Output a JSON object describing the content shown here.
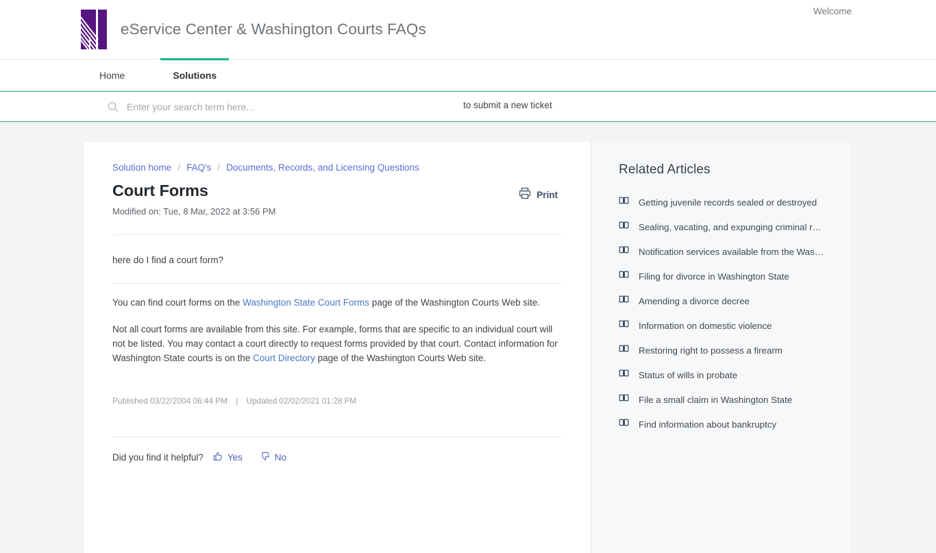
{
  "header": {
    "brand_title": "eService Center & Washington Courts FAQs",
    "welcome": "Welcome",
    "logo_color": "#56157f"
  },
  "nav": {
    "tabs": [
      {
        "label": "Home",
        "active": false
      },
      {
        "label": "Solutions",
        "active": true
      }
    ],
    "accent_color": "#12b886"
  },
  "search": {
    "placeholder": "Enter your search term here...",
    "value": "",
    "ticket_note": "to submit a new ticket",
    "border_color": "#2fae86"
  },
  "breadcrumb": {
    "items": [
      "Solution home",
      "FAQ's",
      "Documents, Records, and Licensing Questions"
    ],
    "separator": "/",
    "link_color": "#5f6bd4"
  },
  "article": {
    "title": "Court Forms",
    "modified": "Modified on: Tue, 8 Mar, 2022 at 3:56 PM",
    "print_label": "Print",
    "question": "here do I find a court form?",
    "paragraph1": {
      "before": "You can find court forms on the ",
      "link": "Washington State Court Forms",
      "after": " page of the Washington Courts Web site."
    },
    "paragraph2": {
      "before": "Not all court forms are available from this site.  For example, forms that are specific to an individual court will not be listed.  You may contact a court directly to request forms provided by that court.  Contact information for Washington State courts is on the ",
      "link": "Court Directory",
      "after": " page of the Washington Courts Web site."
    },
    "published": "Published 03/22/2004 06:44 PM",
    "divider": "|",
    "updated": "Updated 02/02/2021 01:28 PM",
    "helpful_question": "Did you find it helpful?",
    "yes_label": "Yes",
    "no_label": "No",
    "link_color": "#4a77c4"
  },
  "related": {
    "title": "Related Articles",
    "items": [
      {
        "label": "Getting juvenile records sealed or destroyed"
      },
      {
        "label": "Sealing, vacating, and expunging criminal re…"
      },
      {
        "label": "Notification services available from the Was…"
      },
      {
        "label": "Filing for divorce in Washington State"
      },
      {
        "label": "Amending a divorce decree"
      },
      {
        "label": "Information on domestic violence"
      },
      {
        "label": "Restoring right to possess a firearm"
      },
      {
        "label": "Status of wills in probate"
      },
      {
        "label": "File a small claim in Washington State"
      },
      {
        "label": "Find information about bankruptcy"
      }
    ]
  }
}
